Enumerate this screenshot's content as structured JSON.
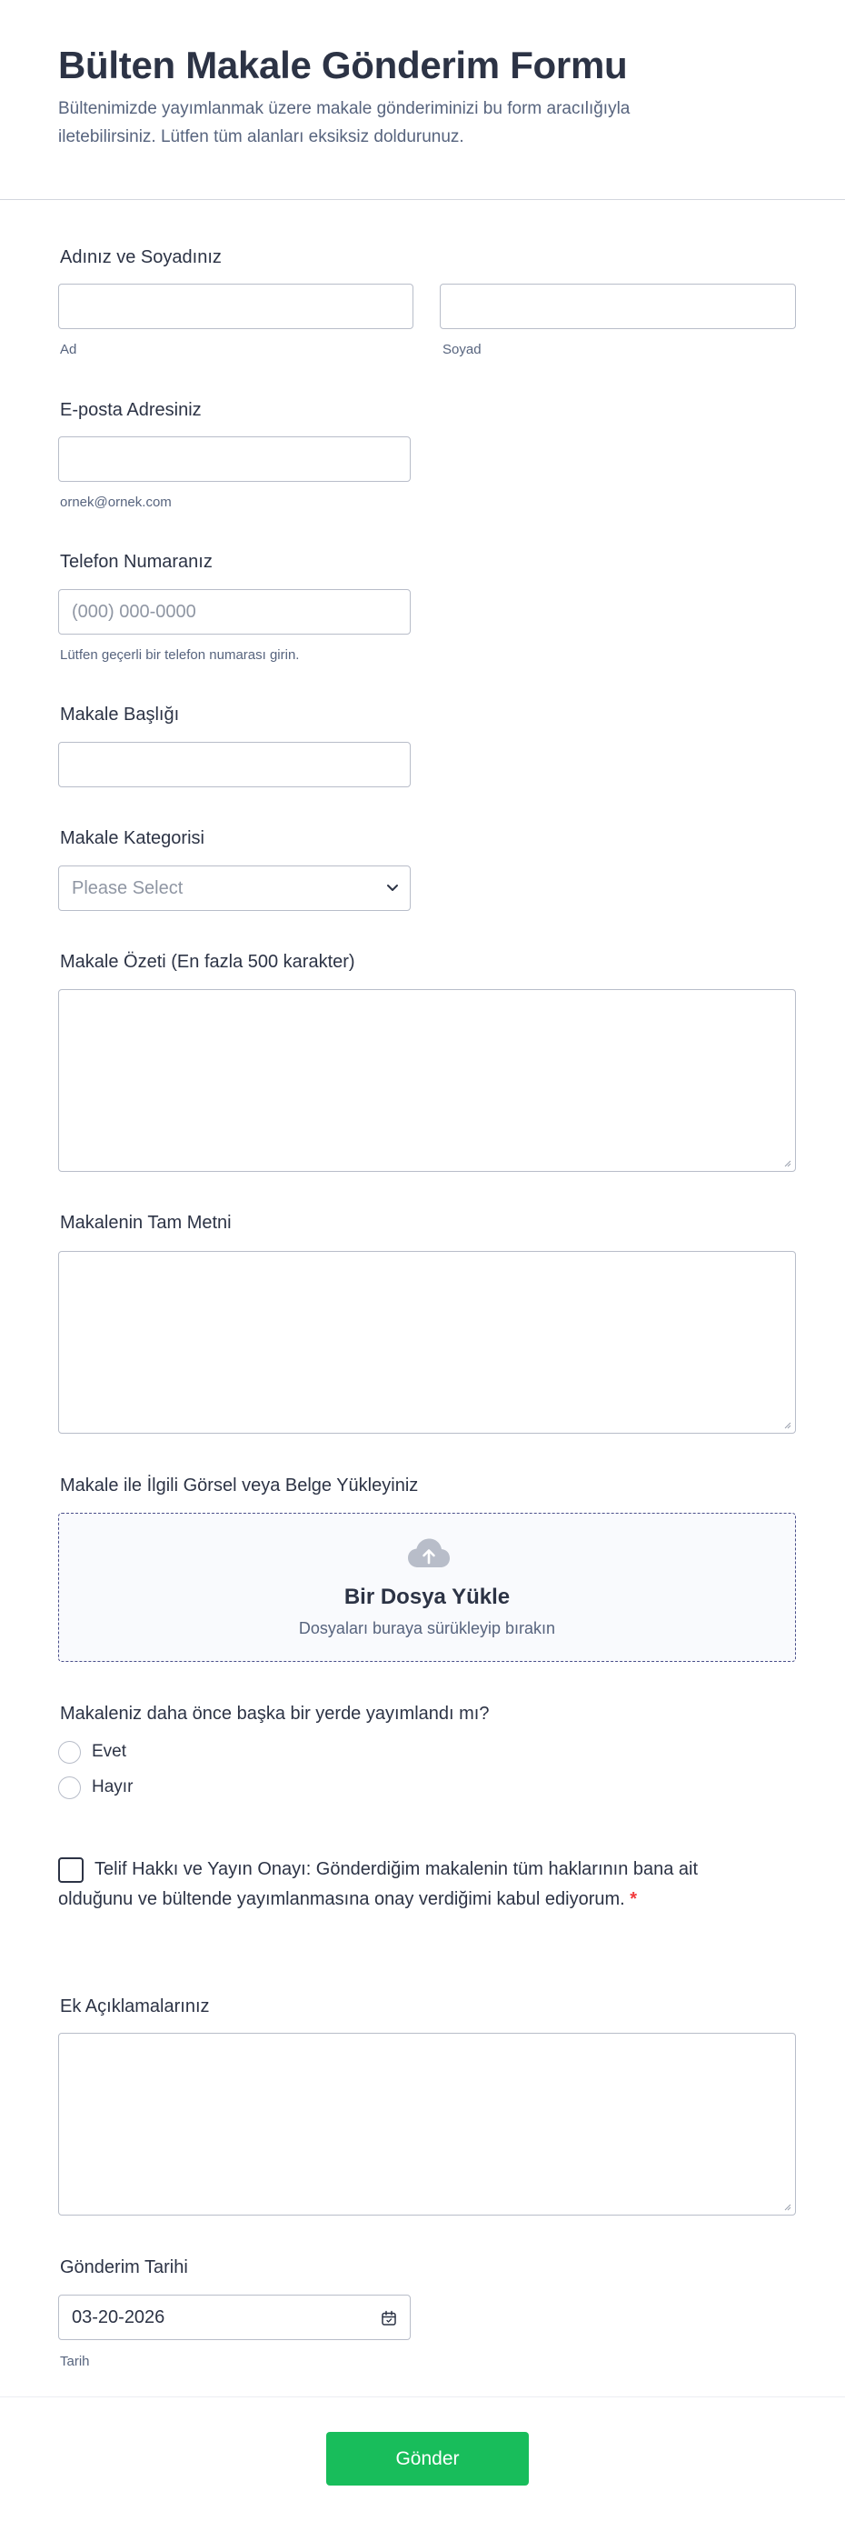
{
  "header": {
    "title": "Bülten Makale Gönderim Formu",
    "description": "Bültenimizde yayımlanmak üzere makale gönderiminizi bu form aracılığıyla iletebilirsiniz. Lütfen tüm alanları eksiksiz doldurunuz."
  },
  "name": {
    "label": "Adınız ve Soyadınız",
    "first_sublabel": "Ad",
    "last_sublabel": "Soyad",
    "first_value": "",
    "last_value": ""
  },
  "email": {
    "label": "E-posta Adresiniz",
    "value": "",
    "sublabel": "ornek@ornek.com"
  },
  "phone": {
    "label": "Telefon Numaranız",
    "placeholder": "(000) 000-0000",
    "sublabel": "Lütfen geçerli bir telefon numarası girin."
  },
  "article_title": {
    "label": "Makale Başlığı",
    "value": ""
  },
  "category": {
    "label": "Makale Kategorisi",
    "selected": "Please Select"
  },
  "summary": {
    "label": "Makale Özeti (En fazla 500 karakter)",
    "value": ""
  },
  "full_text": {
    "label": "Makalenin Tam Metni",
    "value": ""
  },
  "upload": {
    "label": "Makale ile İlgili Görsel veya Belge Yükleyiniz",
    "title": "Bir Dosya Yükle",
    "subtitle": "Dosyaları buraya sürükleyip bırakın",
    "icon": "cloud-upload-icon"
  },
  "published_before": {
    "label": "Makaleniz daha önce başka bir yerde yayımlandı mı?",
    "options": [
      "Evet",
      "Hayır"
    ]
  },
  "consent": {
    "text": "Telif Hakkı ve Yayın Onayı: Gönderdiğim makalenin tüm haklarının bana ait olduğunu ve bültende yayımlanmasına onay verdiğimi kabul ediyorum.",
    "required_mark": "*"
  },
  "notes": {
    "label": "Ek Açıklamalarınız",
    "value": ""
  },
  "date": {
    "label": "Gönderim Tarihi",
    "value": "03-20-2026",
    "sublabel": "Tarih"
  },
  "submit": {
    "label": "Gönder"
  },
  "colors": {
    "submit_bg": "#18bd5b",
    "text": "#2c3345",
    "muted": "#57647e",
    "required": "#f23a3c"
  }
}
